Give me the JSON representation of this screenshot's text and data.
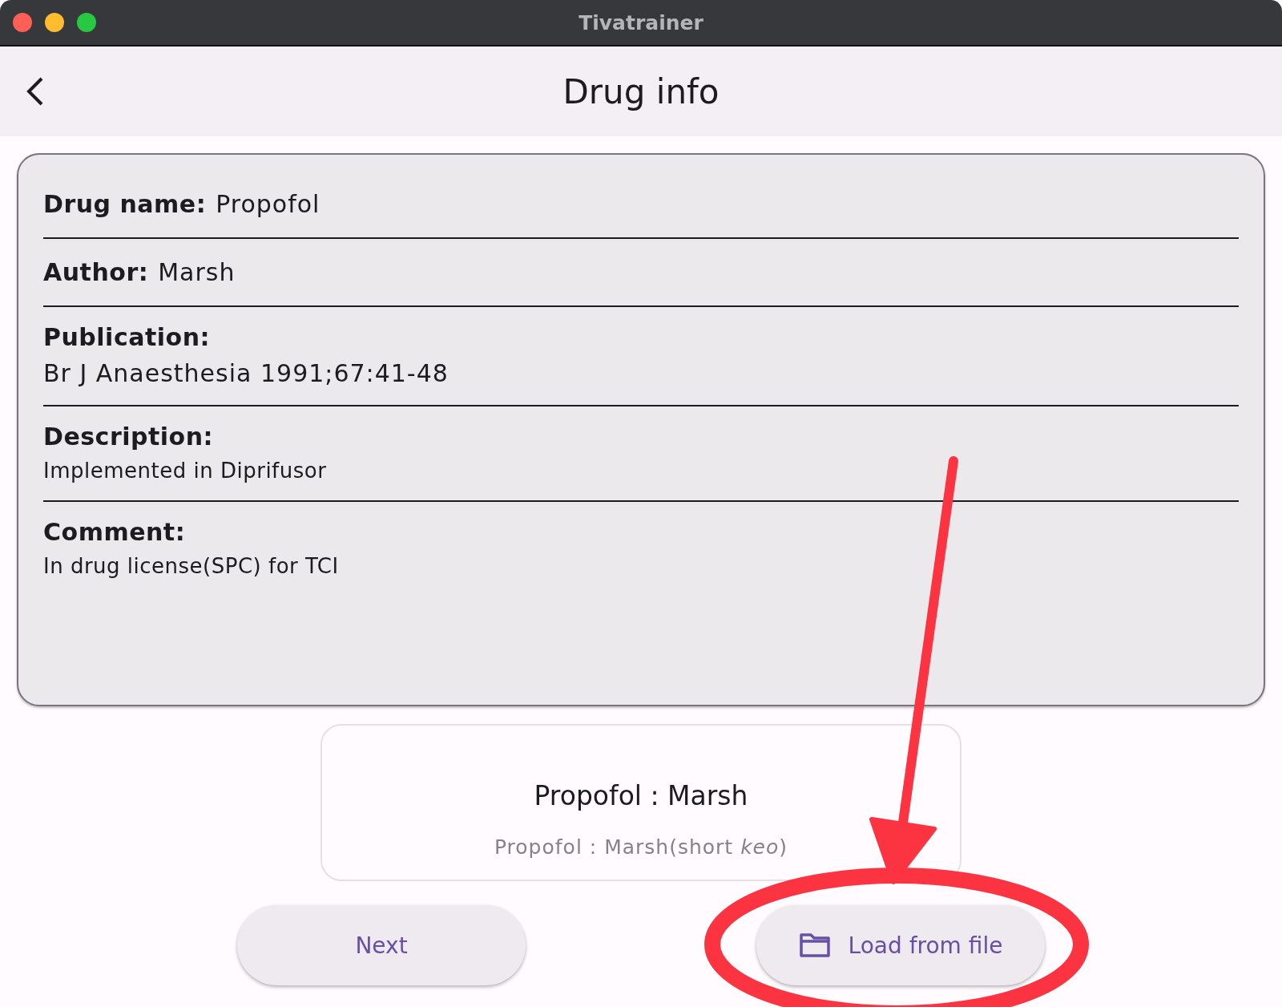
{
  "window": {
    "title": "Tivatrainer"
  },
  "app_bar": {
    "title": "Drug info"
  },
  "fields": [
    {
      "kind": "inline",
      "label": "Drug name:",
      "value": "Propofol"
    },
    {
      "kind": "inline",
      "label": "Author:",
      "value": "Marsh"
    },
    {
      "kind": "stacked",
      "label": "Publication:",
      "value": "Br J Anaesthesia 1991;67:41-48"
    },
    {
      "kind": "stacked",
      "label": "Description:",
      "value": "Implemented in Diprifusor"
    },
    {
      "kind": "stacked",
      "label": "Comment:",
      "value": "In drug license(SPC) for TCI"
    }
  ],
  "picker": {
    "items": [
      {
        "label": "Propofol : Marsh",
        "selected": true
      },
      {
        "label": "Propofol : Marsh(short *keo*)",
        "selected": false
      }
    ]
  },
  "buttons": [
    {
      "kind": "plain",
      "label": "Next"
    },
    {
      "kind": "folder",
      "label": "Load from file"
    }
  ]
}
